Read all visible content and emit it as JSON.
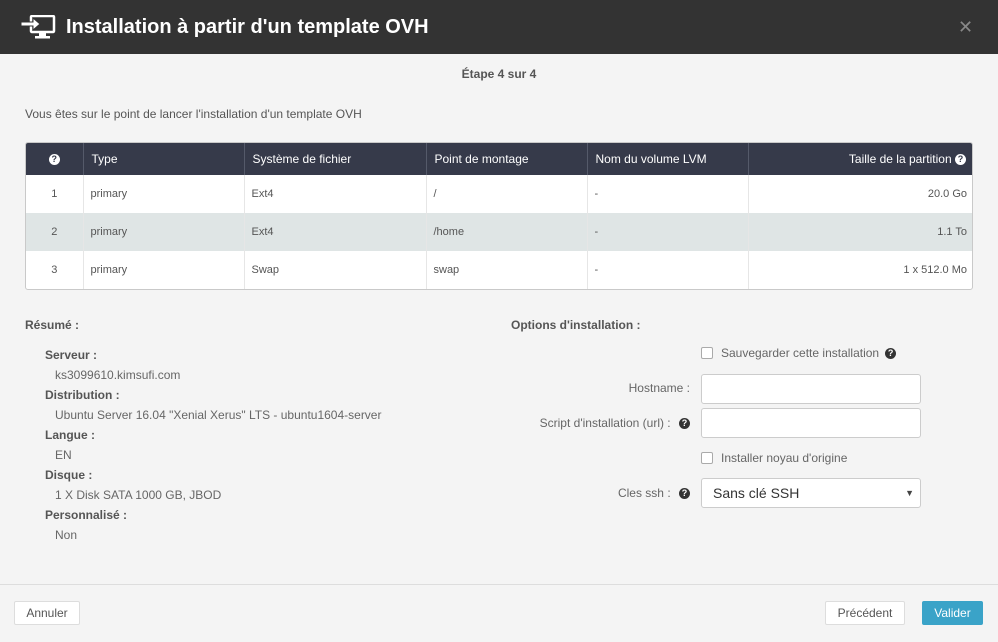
{
  "header": {
    "title": "Installation à partir d'un template OVH",
    "icon": "monitor-import-icon"
  },
  "step": "Étape 4 sur 4",
  "intro": "Vous êtes sur le point de lancer l'installation d'un template OVH",
  "partition_table": {
    "columns": [
      "?",
      "Type",
      "Système de fichier",
      "Point de montage",
      "Nom du volume LVM",
      "Taille de la partition"
    ],
    "rows": [
      [
        "1",
        "primary",
        "Ext4",
        "/",
        "-",
        "20.0 Go"
      ],
      [
        "2",
        "primary",
        "Ext4",
        "/home",
        "-",
        "1.1 To"
      ],
      [
        "3",
        "primary",
        "Swap",
        "swap",
        "-",
        "1 x 512.0 Mo"
      ]
    ]
  },
  "summary": {
    "title": "Résumé :",
    "server_label": "Serveur :",
    "server_value": "ks3099610.kimsufi.com",
    "distribution_label": "Distribution :",
    "distribution_value": "Ubuntu Server 16.04 \"Xenial Xerus\" LTS - ubuntu1604-server",
    "language_label": "Langue :",
    "language_value": "EN",
    "disk_label": "Disque :",
    "disk_value": "1 X Disk SATA 1000 GB, JBOD",
    "custom_label": "Personnalisé :",
    "custom_value": "Non"
  },
  "options": {
    "title": "Options d'installation :",
    "save_install_label": "Sauvegarder cette installation",
    "hostname_label": "Hostname :",
    "script_label": "Script d'installation (url) :",
    "original_kernel_label": "Installer noyau d'origine",
    "ssh_label": "Cles ssh :",
    "ssh_selected": "Sans clé SSH"
  },
  "footer": {
    "cancel_label": "Annuler",
    "previous_label": "Précédent",
    "validate_label": "Valider"
  },
  "colors": {
    "header_bg": "#333333",
    "table_header_bg": "#363a4a",
    "primary_button": "#3aa3c8"
  }
}
